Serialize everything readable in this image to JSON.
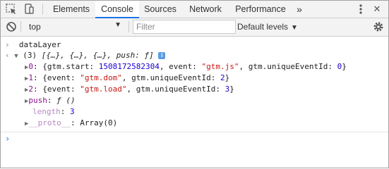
{
  "tabbar": {
    "tabs": [
      {
        "label": "Elements"
      },
      {
        "label": "Console"
      },
      {
        "label": "Sources"
      },
      {
        "label": "Network"
      },
      {
        "label": "Performance"
      }
    ],
    "more": "»",
    "close": "✕",
    "accent": "#1a73e8"
  },
  "toolbar": {
    "context": "top",
    "filter_placeholder": "Filter",
    "levels": "Default levels"
  },
  "console": {
    "command": "dataLayer",
    "summary": {
      "count": "(3)",
      "items": "[{…}, {…}, {…}, push: ƒ]"
    },
    "entries": [
      {
        "index": "0",
        "k1": "gtm.start",
        "v1": "1508172582304",
        "k2": "event",
        "v2": "\"gtm.js\"",
        "k3": "gtm.uniqueEventId",
        "v3": "0"
      },
      {
        "index": "1",
        "k1": "event",
        "v1": "\"gtm.dom\"",
        "k2": "gtm.uniqueEventId",
        "v2": "2"
      },
      {
        "index": "2",
        "k1": "event",
        "v1": "\"gtm.load\"",
        "k2": "gtm.uniqueEventId",
        "v2": "3"
      }
    ],
    "push": {
      "key": "push",
      "value": "ƒ ()"
    },
    "length": {
      "key": "length",
      "value": "3"
    },
    "proto": {
      "key": "__proto__",
      "value": "Array(0)"
    }
  }
}
